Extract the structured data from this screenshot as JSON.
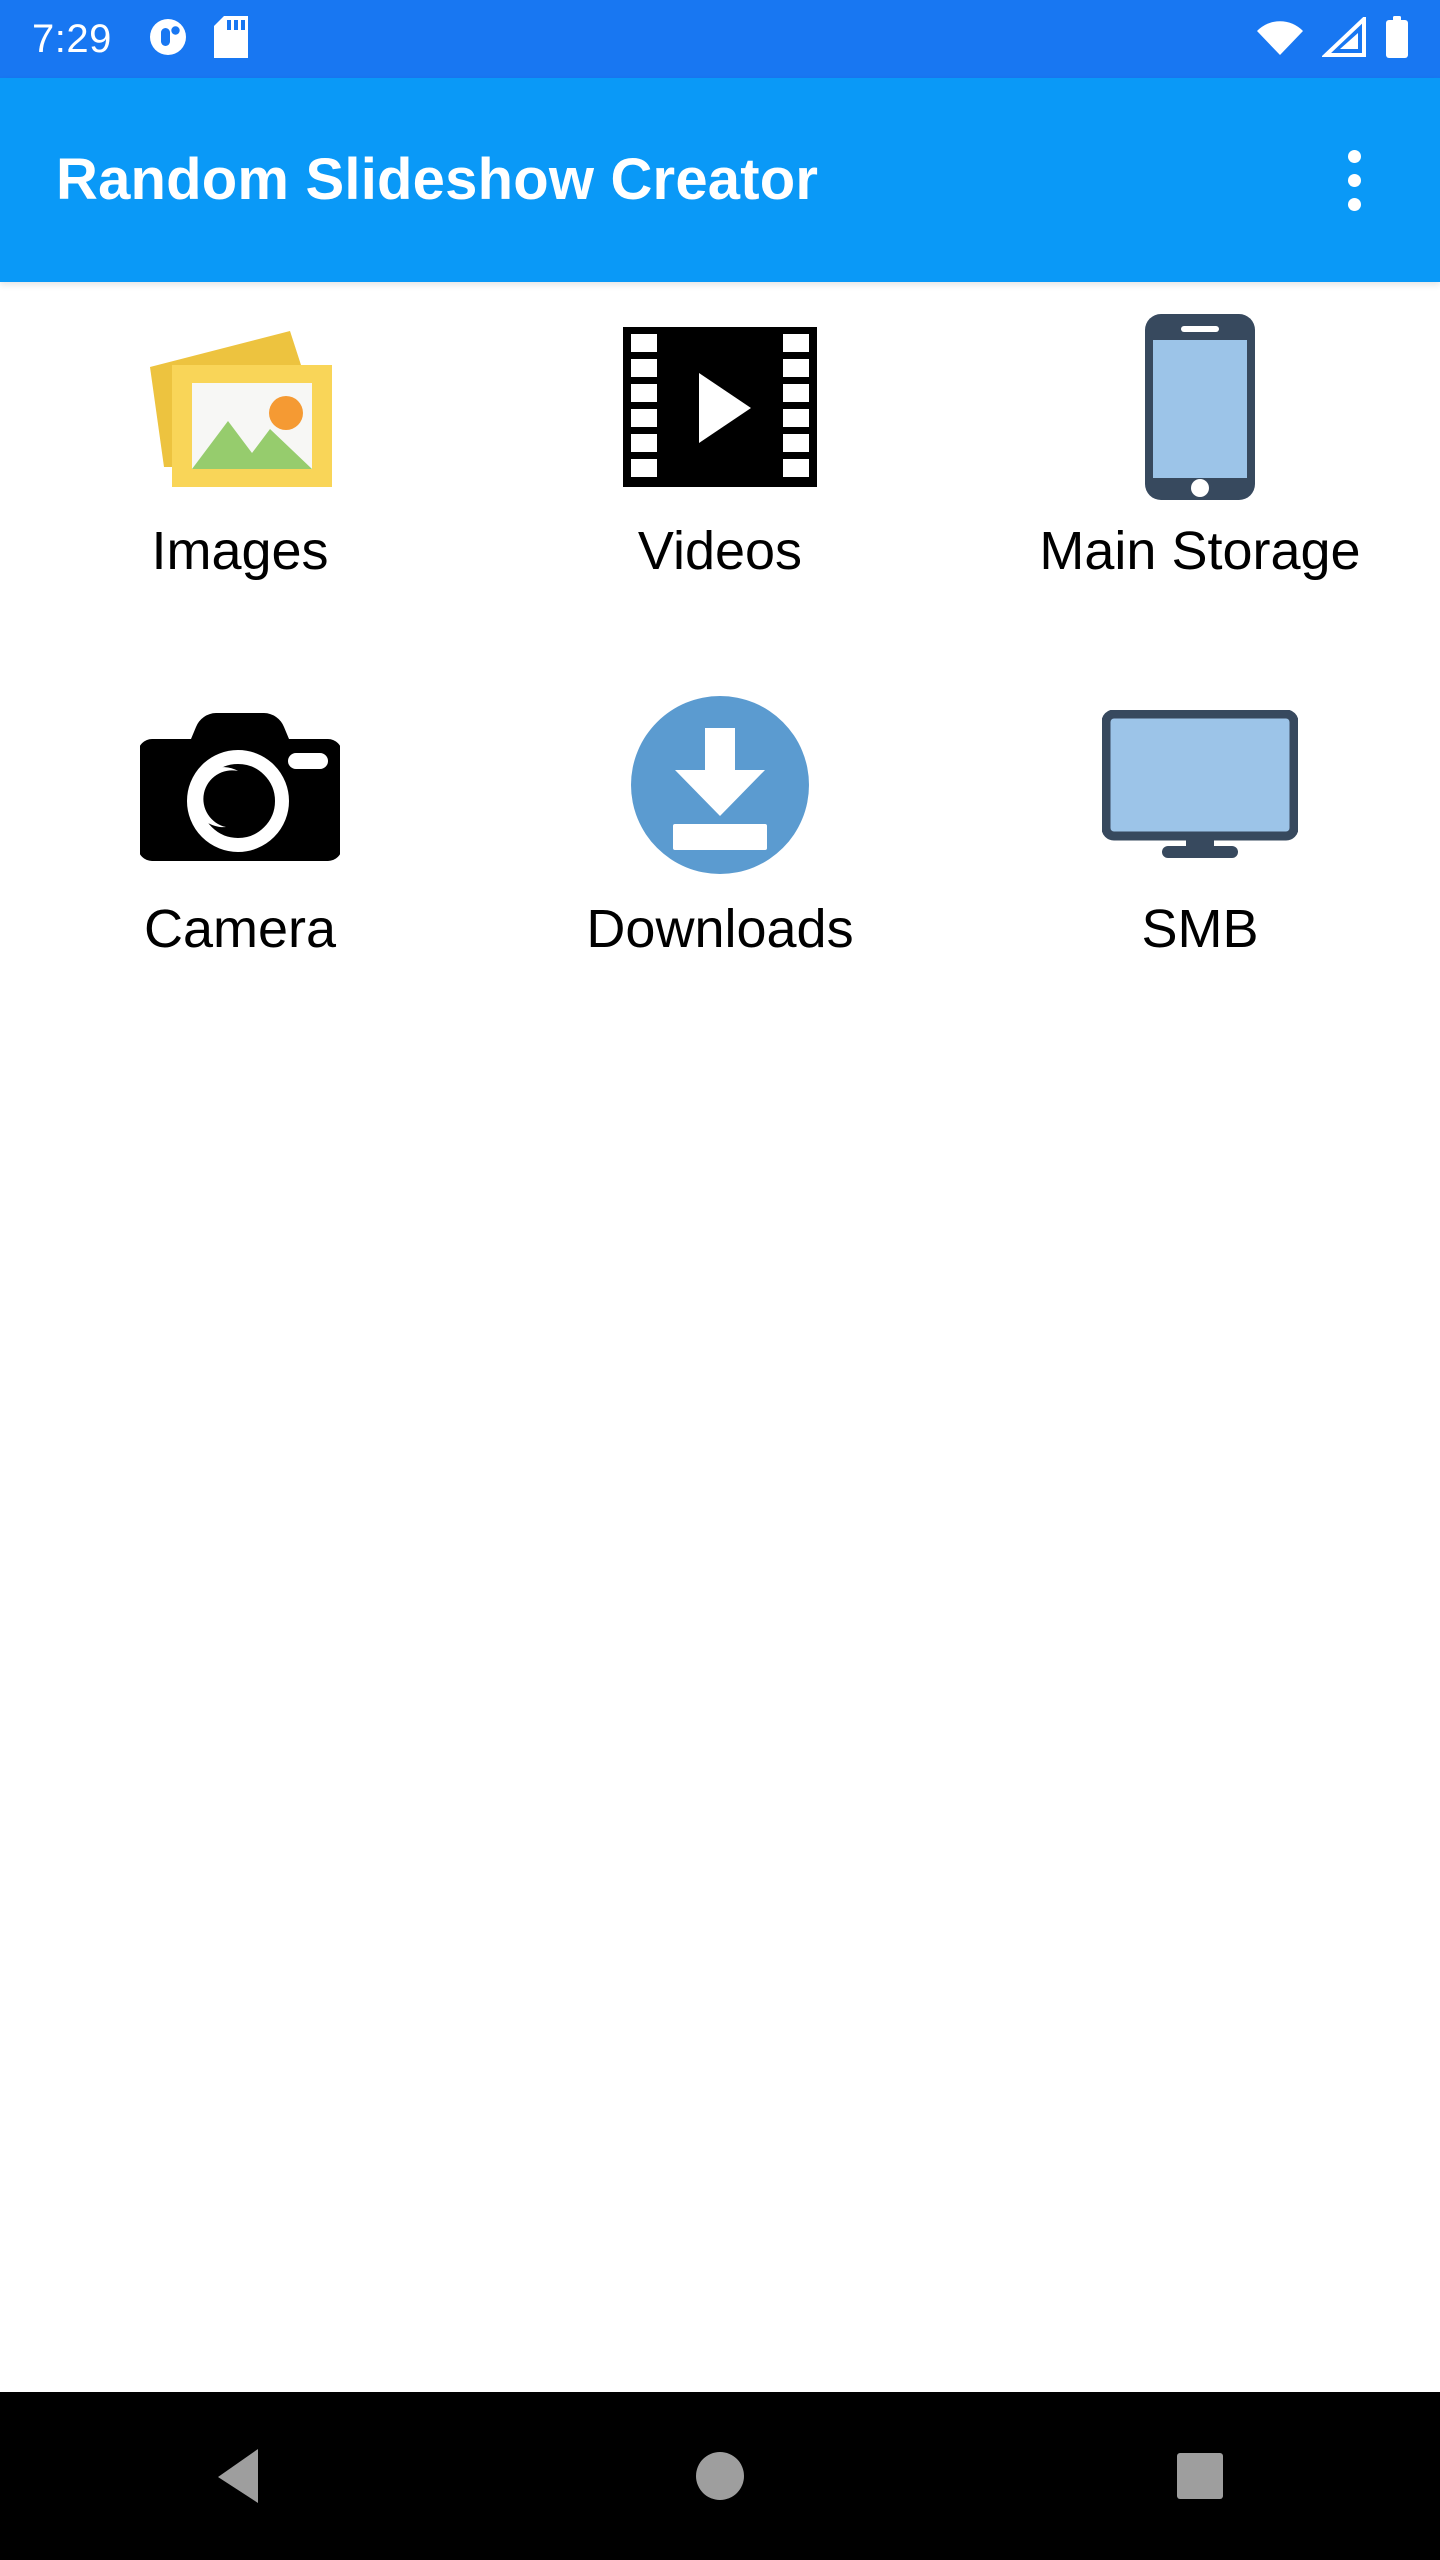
{
  "status_bar": {
    "clock": "7:29",
    "background_color": "#1877f2",
    "icons": [
      {
        "name": "app-notification-icon",
        "label": "notification"
      },
      {
        "name": "sd-card-icon",
        "label": "sd card"
      }
    ],
    "right_icons": [
      {
        "name": "wifi-icon",
        "label": "wifi"
      },
      {
        "name": "cellular-signal-icon",
        "label": "signal"
      },
      {
        "name": "battery-icon",
        "label": "battery"
      }
    ]
  },
  "app_bar": {
    "title": "Random Slideshow Creator",
    "background_color": "#0a99f7",
    "title_color": "#ffffff",
    "overflow_menu": "overflow-menu"
  },
  "grid": {
    "items": [
      {
        "label": "Images",
        "icon": "images-icon"
      },
      {
        "label": "Videos",
        "icon": "videos-icon"
      },
      {
        "label": "Main Storage",
        "icon": "phone-icon"
      },
      {
        "label": "Camera",
        "icon": "camera-icon"
      },
      {
        "label": "Downloads",
        "icon": "download-icon"
      },
      {
        "label": "SMB",
        "icon": "monitor-icon"
      }
    ]
  },
  "nav_bar": {
    "background_color": "#000000",
    "icon_color": "#9e9e9e",
    "buttons": [
      {
        "name": "nav-back-button",
        "label": "Back"
      },
      {
        "name": "nav-home-button",
        "label": "Home"
      },
      {
        "name": "nav-recents-button",
        "label": "Recents"
      }
    ]
  },
  "colors": {
    "status_bar": "#1877f2",
    "app_bar": "#0a99f7",
    "page_background": "#ffffff",
    "label_text": "#000000",
    "images_yellow": "#f7cf4a",
    "images_yellow_back": "#edc33f",
    "images_green": "#96cc6d",
    "images_orange": "#f59a33",
    "videos_black": "#000000",
    "phone_navy": "#37495e",
    "phone_screen": "#9cc4e8",
    "camera_black": "#000000",
    "download_blue": "#5b9bd0",
    "monitor_navy": "#37495e",
    "monitor_screen": "#9cc4e8"
  }
}
